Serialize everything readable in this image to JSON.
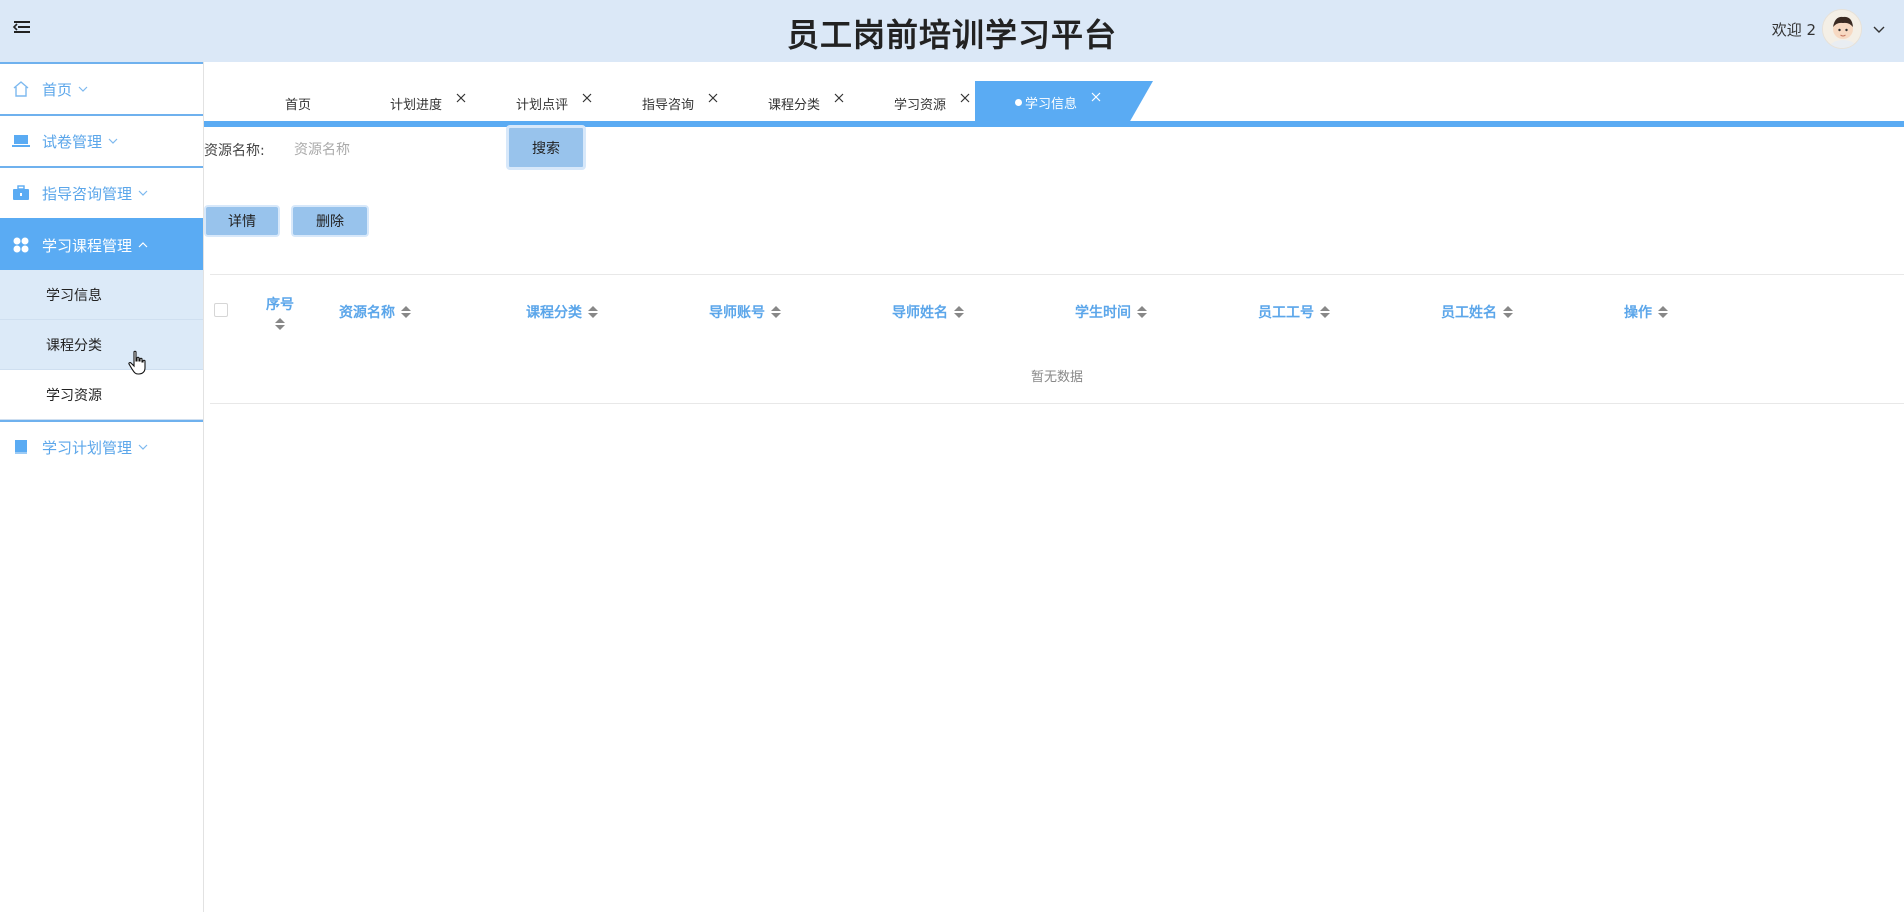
{
  "header": {
    "title": "员工岗前培训学习平台",
    "welcome": "欢迎 2"
  },
  "sidebar": {
    "items": [
      {
        "label": "首页",
        "icon": "home-icon"
      },
      {
        "label": "试卷管理",
        "icon": "laptop-icon"
      },
      {
        "label": "指导咨询管理",
        "icon": "briefcase-icon"
      },
      {
        "label": "学习课程管理",
        "icon": "apps-icon"
      },
      {
        "label": "学习计划管理",
        "icon": "book-icon"
      }
    ],
    "subitems": [
      "学习信息",
      "课程分类",
      "学习资源"
    ]
  },
  "tabs": [
    {
      "label": "首页"
    },
    {
      "label": "计划进度"
    },
    {
      "label": "计划点评"
    },
    {
      "label": "指导咨询"
    },
    {
      "label": "课程分类"
    },
    {
      "label": "学习资源"
    },
    {
      "label": "学习信息"
    }
  ],
  "search": {
    "label": "资源名称:",
    "placeholder": "资源名称",
    "button": "搜索"
  },
  "actions": {
    "detail": "详情",
    "delete": "删除"
  },
  "table": {
    "columns": [
      "序号",
      "资源名称",
      "课程分类",
      "导师账号",
      "导师姓名",
      "学生时间",
      "员工工号",
      "员工姓名",
      "操作"
    ],
    "empty_text": "暂无数据"
  },
  "colors": {
    "accent": "#5aabf3",
    "header_bg": "#dbe8f7",
    "link": "#5ba6ea"
  }
}
